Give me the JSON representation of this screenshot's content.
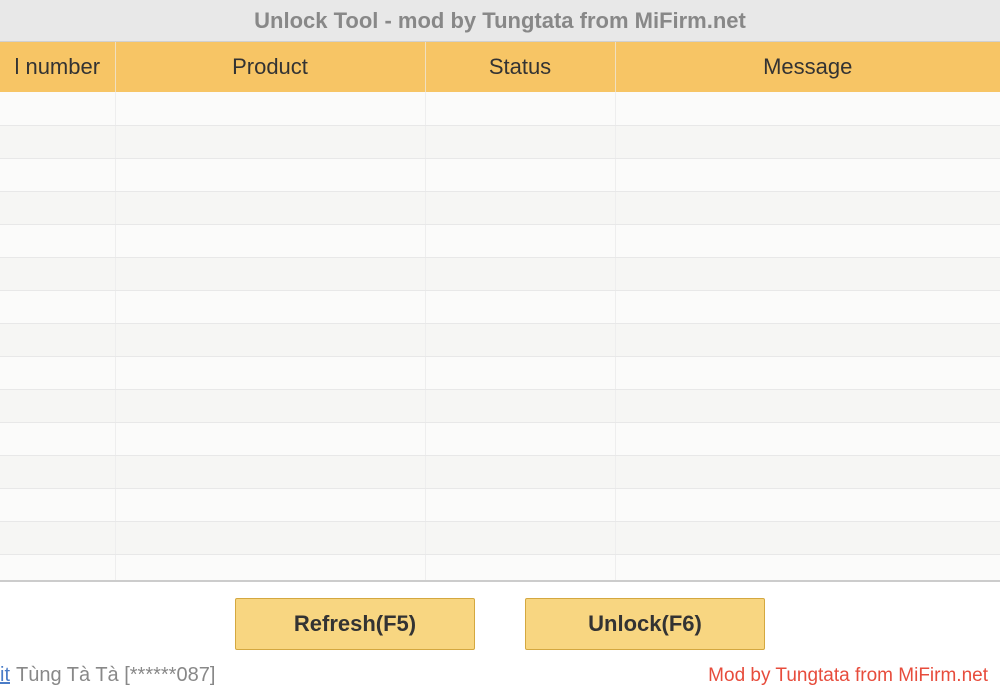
{
  "window": {
    "title": "Unlock Tool - mod by Tungtata from MiFirm.net"
  },
  "table": {
    "headers": {
      "serial": "l number",
      "product": "Product",
      "status": "Status",
      "message": "Message"
    },
    "rowCount": 15
  },
  "buttons": {
    "refresh": "Refresh(F5)",
    "unlock": "Unlock(F6)"
  },
  "footer": {
    "logout_partial": "it",
    "user_display": "Tùng Tà Tà [******087]",
    "mod_credit": "Mod by Tungtata from MiFirm.net"
  }
}
